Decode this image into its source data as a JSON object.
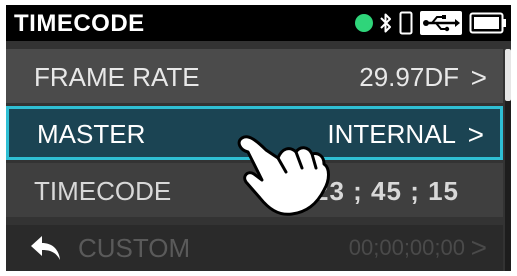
{
  "header": {
    "title": "TIMECODE",
    "status_dot_color": "#2fd57a",
    "icons": [
      "status-dot",
      "bluetooth-icon",
      "phone-icon",
      "usb-icon",
      "battery-icon"
    ]
  },
  "menu": {
    "items": [
      {
        "label": "FRAME RATE",
        "value": "29.97DF",
        "chevron": ">"
      },
      {
        "label": "MASTER",
        "value": "INTERNAL",
        "chevron": ">",
        "selected": true
      },
      {
        "label": "TIMECODE",
        "value": "00 ; 23 ; 45 ; 15"
      },
      {
        "label": "CUSTOM",
        "value": "00;00;00;00",
        "chevron": ">",
        "disabled": true
      }
    ]
  },
  "colors": {
    "selected_border": "#2fbfd4",
    "selected_bg": "#1b4453"
  },
  "overlay": {
    "icon": "pointing-hand-icon"
  }
}
